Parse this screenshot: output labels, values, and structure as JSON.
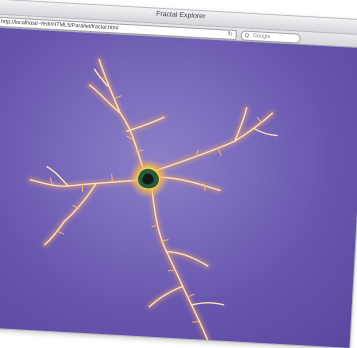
{
  "window": {
    "title": "Fractal Explorer"
  },
  "toolbar": {
    "address": "http://localhost/~fedr/HTML5/Parallel/fractal.html",
    "search_placeholder": "Google"
  },
  "icons": {
    "reload": "reload-icon",
    "search": "search-icon"
  },
  "colors": {
    "background": "#6856ad",
    "filament_glow": "#f2a66a",
    "filament_core": "#fde2b8",
    "core_yellow": "#f8e050",
    "core_green": "#2a5a3c"
  }
}
